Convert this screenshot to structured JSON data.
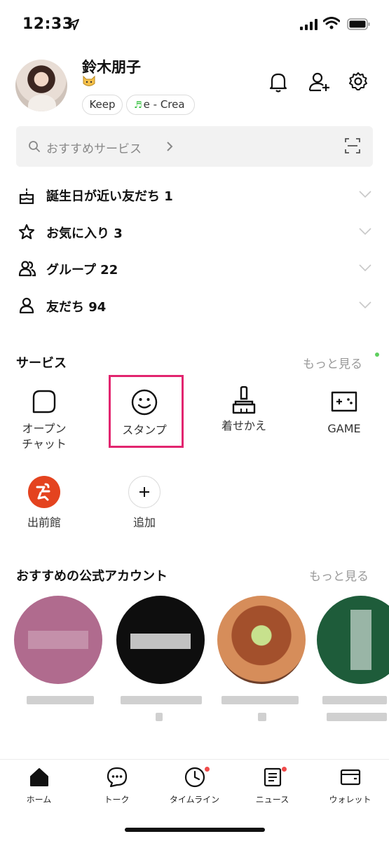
{
  "status_bar": {
    "time": "12:33"
  },
  "profile": {
    "name": "鈴木朋子",
    "chips": {
      "keep": "Keep",
      "music": "e - Crea"
    }
  },
  "search": {
    "placeholder": "おすすめサービス"
  },
  "friends": [
    {
      "label": "誕生日が近い友だち 1",
      "icon": "birthday-cake-icon"
    },
    {
      "label": "お気に入り 3",
      "icon": "star-icon"
    },
    {
      "label": "グループ 22",
      "icon": "group-icon"
    },
    {
      "label": "友だち 94",
      "icon": "person-icon"
    }
  ],
  "services": {
    "title": "サービス",
    "more": "もっと見る",
    "items": [
      {
        "label": "オープン\nチャット",
        "icon": "open-chat-icon"
      },
      {
        "label": "スタンプ",
        "icon": "smiley-icon"
      },
      {
        "label": "着せかえ",
        "icon": "brush-icon"
      },
      {
        "label": "GAME",
        "icon": "gamepad-icon"
      },
      {
        "label": "出前館",
        "icon": "demaekan-icon"
      },
      {
        "label": "追加",
        "icon": "plus-icon"
      }
    ]
  },
  "official_accounts": {
    "title": "おすすめの公式アカウント",
    "more": "もっと見る"
  },
  "tab_bar": [
    {
      "label": "ホーム",
      "icon": "home-icon"
    },
    {
      "label": "トーク",
      "icon": "chat-icon"
    },
    {
      "label": "タイムライン",
      "icon": "clock-icon"
    },
    {
      "label": "ニュース",
      "icon": "news-icon"
    },
    {
      "label": "ウォレット",
      "icon": "wallet-icon"
    }
  ],
  "colors": {
    "highlight": "#e2256f",
    "notification_dot": "#f04b4b",
    "more_dot": "#5ecf5e",
    "demae": "#e4431f"
  }
}
